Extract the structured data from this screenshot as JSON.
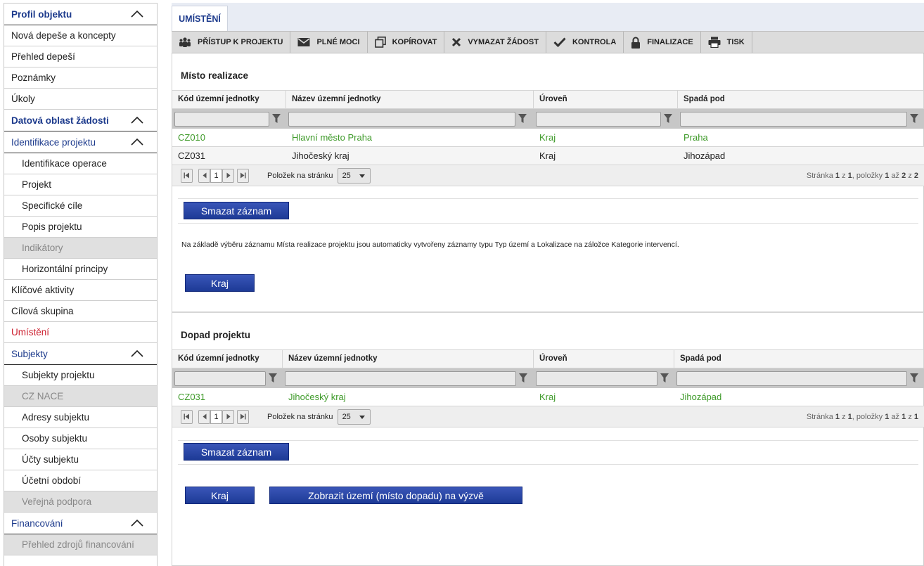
{
  "sidebar": {
    "items": [
      {
        "label": "Profil objektu",
        "type": "section",
        "expanded": true
      },
      {
        "label": "Nová depeše a koncepty",
        "type": "item"
      },
      {
        "label": "Přehled depeší",
        "type": "item"
      },
      {
        "label": "Poznámky",
        "type": "item"
      },
      {
        "label": "Úkoly",
        "type": "item"
      },
      {
        "label": "Datová oblast žádosti",
        "type": "section",
        "expanded": true
      },
      {
        "label": "Identifikace projektu",
        "type": "subsection",
        "expanded": true
      },
      {
        "label": "Identifikace operace",
        "type": "subitem"
      },
      {
        "label": "Projekt",
        "type": "subitem"
      },
      {
        "label": "Specifické cíle",
        "type": "subitem"
      },
      {
        "label": "Popis projektu",
        "type": "subitem"
      },
      {
        "label": "Indikátory",
        "type": "subitem",
        "disabled": true
      },
      {
        "label": "Horizontální principy",
        "type": "subitem"
      },
      {
        "label": "Klíčové aktivity",
        "type": "item"
      },
      {
        "label": "Cílová skupina",
        "type": "item"
      },
      {
        "label": "Umístění",
        "type": "item",
        "active": true
      },
      {
        "label": "Subjekty",
        "type": "subsection",
        "expanded": true
      },
      {
        "label": "Subjekty projektu",
        "type": "subitem"
      },
      {
        "label": "CZ NACE",
        "type": "subitem",
        "disabled": true
      },
      {
        "label": "Adresy subjektu",
        "type": "subitem"
      },
      {
        "label": "Osoby subjektu",
        "type": "subitem"
      },
      {
        "label": "Účty subjektu",
        "type": "subitem"
      },
      {
        "label": "Účetní období",
        "type": "subitem"
      },
      {
        "label": "Veřejná podpora",
        "type": "subitem",
        "disabled": true
      },
      {
        "label": "Financování",
        "type": "subsection",
        "expanded": true
      },
      {
        "label": "Přehled zdrojů financování",
        "type": "subitem",
        "disabled": true
      }
    ]
  },
  "tab": {
    "label": "UMÍSTĚNÍ"
  },
  "toolbar": {
    "buttons": [
      {
        "label": "PŘÍSTUP K PROJEKTU",
        "icon": "people-icon"
      },
      {
        "label": "PLNÉ MOCI",
        "icon": "envelope-icon"
      },
      {
        "label": "KOPÍROVAT",
        "icon": "copy-icon"
      },
      {
        "label": "VYMAZAT ŽÁDOST",
        "icon": "cross-icon"
      },
      {
        "label": "KONTROLA",
        "icon": "check-icon"
      },
      {
        "label": "FINALIZACE",
        "icon": "lock-icon"
      },
      {
        "label": "TISK",
        "icon": "printer-icon"
      }
    ]
  },
  "misto": {
    "title": "Místo realizace",
    "columns": [
      "Kód územní jednotky",
      "Název územní jednotky",
      "Úroveň",
      "Spadá pod"
    ],
    "rows": [
      [
        "CZ010",
        "Hlavní město Praha",
        "Kraj",
        "Praha"
      ],
      [
        "CZ031",
        "Jihočeský kraj",
        "Kraj",
        "Jihozápad"
      ]
    ],
    "pager": {
      "page": "1",
      "per_page_label": "Položek na stránku",
      "per_page": "25",
      "info_prefix": "Stránka",
      "info_page": "1",
      "info_of": "z",
      "info_pages": "1",
      "info_items": ", položky",
      "info_from": "1",
      "info_to_word": "až",
      "info_to": "2",
      "info_total_of": "z",
      "info_total": "2"
    },
    "delete_button": "Smazat záznam",
    "info_text": "Na základě výběru záznamu Místa realizace projektu jsou automaticky vytvořeny záznamy typu Typ území a Lokalizace na záložce Kategorie intervencí.",
    "kraj_button": "Kraj"
  },
  "dopad": {
    "title": "Dopad projektu",
    "columns": [
      "Kód územní jednotky",
      "Název územní jednotky",
      "Úroveň",
      "Spadá pod"
    ],
    "rows": [
      [
        "CZ031",
        "Jihočeský kraj",
        "Kraj",
        "Jihozápad"
      ]
    ],
    "pager": {
      "page": "1",
      "per_page_label": "Položek na stránku",
      "per_page": "25",
      "info_prefix": "Stránka",
      "info_page": "1",
      "info_of": "z",
      "info_pages": "1",
      "info_items": ", položky",
      "info_from": "1",
      "info_to_word": "až",
      "info_to": "1",
      "info_total_of": "z",
      "info_total": "1"
    },
    "delete_button": "Smazat záznam",
    "kraj_button": "Kraj",
    "show_button": "Zobrazit území (místo dopadu) na výzvě"
  },
  "colors": {
    "accent": "#1c3a8c",
    "active": "#cc1f2e",
    "selected_row": "#3e9a29",
    "button": "#1d3a96"
  }
}
